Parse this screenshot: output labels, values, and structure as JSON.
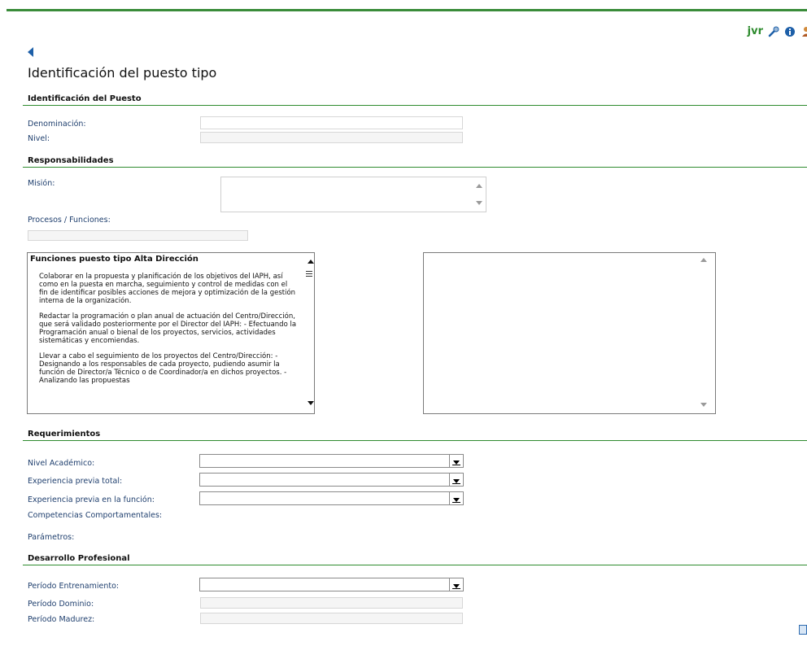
{
  "header": {
    "username": "jvr",
    "icons": [
      "wrench-icon",
      "info-icon",
      "user-icon"
    ]
  },
  "page": {
    "title": "Identificación del puesto tipo",
    "back_icon": "back-arrow-icon"
  },
  "sections": {
    "identificacion": {
      "title": "Identificación del Puesto",
      "denominacion_label": "Denominación:",
      "denominacion_value": "",
      "nivel_label": "Nivel:",
      "nivel_value": ""
    },
    "responsabilidades": {
      "title": "Responsabilidades",
      "mision_label": "Misión:",
      "mision_value": "",
      "procesos_label": "Procesos / Funciones:",
      "procesos_value": "",
      "funciones_title": "Funciones puesto tipo Alta Dirección",
      "funciones_paragraphs": [
        "Colaborar en la propuesta y planificación de los objetivos del IAPH, así como en la puesta en marcha, seguimiento y control de medidas con el fin de identificar posibles acciones de mejora y optimización de la gestión interna de la organización.",
        "Redactar la programación o plan anual de actuación del Centro/Dirección, que será validado posteriormente por el Director del IAPH: - Efectuando la Programación anual o bienal de los proyectos, servicios, actividades sistemáticas y encomiendas.",
        "Llevar a cabo el seguimiento de los proyectos del Centro/Dirección: - Designando a los responsables de cada proyecto, pudiendo asumir la función de Director/a Técnico o de Coordinador/a en dichos proyectos. - Analizando las propuestas"
      ]
    },
    "requerimientos": {
      "title": "Requerimientos",
      "nivel_academico_label": "Nivel Académico:",
      "nivel_academico_value": "",
      "experiencia_total_label": "Experiencia previa total:",
      "experiencia_total_value": "",
      "experiencia_funcion_label": "Experiencia previa en la función:",
      "experiencia_funcion_value": "",
      "competencias_label": "Competencias Comportamentales:",
      "parametros_label": "Parámetros:"
    },
    "desarrollo": {
      "title": "Desarrollo Profesional",
      "entrenamiento_label": "Período Entrenamiento:",
      "entrenamiento_value": "",
      "dominio_label": "Período Dominio:",
      "dominio_value": "",
      "madurez_label": "Período Madurez:",
      "madurez_value": ""
    }
  },
  "colors": {
    "accent": "#2e8b2e",
    "label": "#1f3f6e",
    "link": "#1d5fa8"
  }
}
